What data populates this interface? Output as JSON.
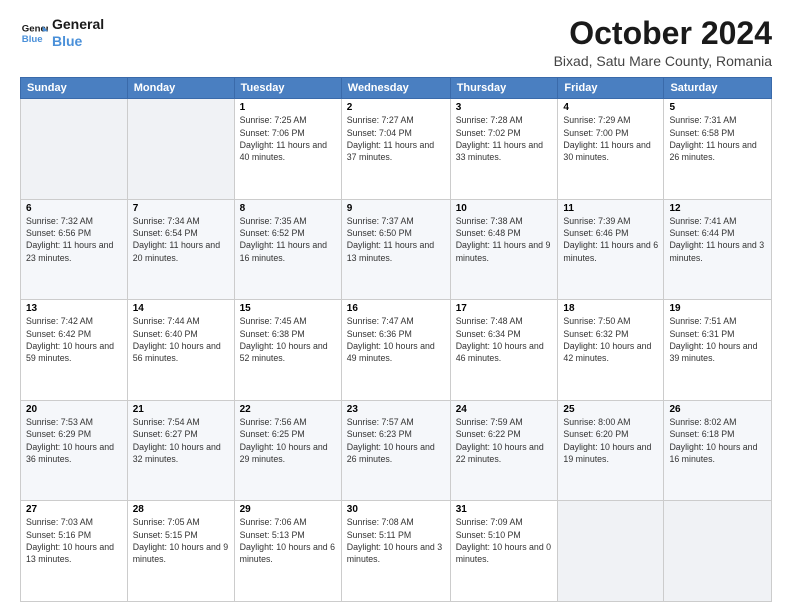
{
  "header": {
    "logo_line1": "General",
    "logo_line2": "Blue",
    "month": "October 2024",
    "location": "Bixad, Satu Mare County, Romania"
  },
  "weekdays": [
    "Sunday",
    "Monday",
    "Tuesday",
    "Wednesday",
    "Thursday",
    "Friday",
    "Saturday"
  ],
  "weeks": [
    [
      {
        "day": "",
        "info": ""
      },
      {
        "day": "",
        "info": ""
      },
      {
        "day": "1",
        "info": "Sunrise: 7:25 AM\nSunset: 7:06 PM\nDaylight: 11 hours and 40 minutes."
      },
      {
        "day": "2",
        "info": "Sunrise: 7:27 AM\nSunset: 7:04 PM\nDaylight: 11 hours and 37 minutes."
      },
      {
        "day": "3",
        "info": "Sunrise: 7:28 AM\nSunset: 7:02 PM\nDaylight: 11 hours and 33 minutes."
      },
      {
        "day": "4",
        "info": "Sunrise: 7:29 AM\nSunset: 7:00 PM\nDaylight: 11 hours and 30 minutes."
      },
      {
        "day": "5",
        "info": "Sunrise: 7:31 AM\nSunset: 6:58 PM\nDaylight: 11 hours and 26 minutes."
      }
    ],
    [
      {
        "day": "6",
        "info": "Sunrise: 7:32 AM\nSunset: 6:56 PM\nDaylight: 11 hours and 23 minutes."
      },
      {
        "day": "7",
        "info": "Sunrise: 7:34 AM\nSunset: 6:54 PM\nDaylight: 11 hours and 20 minutes."
      },
      {
        "day": "8",
        "info": "Sunrise: 7:35 AM\nSunset: 6:52 PM\nDaylight: 11 hours and 16 minutes."
      },
      {
        "day": "9",
        "info": "Sunrise: 7:37 AM\nSunset: 6:50 PM\nDaylight: 11 hours and 13 minutes."
      },
      {
        "day": "10",
        "info": "Sunrise: 7:38 AM\nSunset: 6:48 PM\nDaylight: 11 hours and 9 minutes."
      },
      {
        "day": "11",
        "info": "Sunrise: 7:39 AM\nSunset: 6:46 PM\nDaylight: 11 hours and 6 minutes."
      },
      {
        "day": "12",
        "info": "Sunrise: 7:41 AM\nSunset: 6:44 PM\nDaylight: 11 hours and 3 minutes."
      }
    ],
    [
      {
        "day": "13",
        "info": "Sunrise: 7:42 AM\nSunset: 6:42 PM\nDaylight: 10 hours and 59 minutes."
      },
      {
        "day": "14",
        "info": "Sunrise: 7:44 AM\nSunset: 6:40 PM\nDaylight: 10 hours and 56 minutes."
      },
      {
        "day": "15",
        "info": "Sunrise: 7:45 AM\nSunset: 6:38 PM\nDaylight: 10 hours and 52 minutes."
      },
      {
        "day": "16",
        "info": "Sunrise: 7:47 AM\nSunset: 6:36 PM\nDaylight: 10 hours and 49 minutes."
      },
      {
        "day": "17",
        "info": "Sunrise: 7:48 AM\nSunset: 6:34 PM\nDaylight: 10 hours and 46 minutes."
      },
      {
        "day": "18",
        "info": "Sunrise: 7:50 AM\nSunset: 6:32 PM\nDaylight: 10 hours and 42 minutes."
      },
      {
        "day": "19",
        "info": "Sunrise: 7:51 AM\nSunset: 6:31 PM\nDaylight: 10 hours and 39 minutes."
      }
    ],
    [
      {
        "day": "20",
        "info": "Sunrise: 7:53 AM\nSunset: 6:29 PM\nDaylight: 10 hours and 36 minutes."
      },
      {
        "day": "21",
        "info": "Sunrise: 7:54 AM\nSunset: 6:27 PM\nDaylight: 10 hours and 32 minutes."
      },
      {
        "day": "22",
        "info": "Sunrise: 7:56 AM\nSunset: 6:25 PM\nDaylight: 10 hours and 29 minutes."
      },
      {
        "day": "23",
        "info": "Sunrise: 7:57 AM\nSunset: 6:23 PM\nDaylight: 10 hours and 26 minutes."
      },
      {
        "day": "24",
        "info": "Sunrise: 7:59 AM\nSunset: 6:22 PM\nDaylight: 10 hours and 22 minutes."
      },
      {
        "day": "25",
        "info": "Sunrise: 8:00 AM\nSunset: 6:20 PM\nDaylight: 10 hours and 19 minutes."
      },
      {
        "day": "26",
        "info": "Sunrise: 8:02 AM\nSunset: 6:18 PM\nDaylight: 10 hours and 16 minutes."
      }
    ],
    [
      {
        "day": "27",
        "info": "Sunrise: 7:03 AM\nSunset: 5:16 PM\nDaylight: 10 hours and 13 minutes."
      },
      {
        "day": "28",
        "info": "Sunrise: 7:05 AM\nSunset: 5:15 PM\nDaylight: 10 hours and 9 minutes."
      },
      {
        "day": "29",
        "info": "Sunrise: 7:06 AM\nSunset: 5:13 PM\nDaylight: 10 hours and 6 minutes."
      },
      {
        "day": "30",
        "info": "Sunrise: 7:08 AM\nSunset: 5:11 PM\nDaylight: 10 hours and 3 minutes."
      },
      {
        "day": "31",
        "info": "Sunrise: 7:09 AM\nSunset: 5:10 PM\nDaylight: 10 hours and 0 minutes."
      },
      {
        "day": "",
        "info": ""
      },
      {
        "day": "",
        "info": ""
      }
    ]
  ]
}
